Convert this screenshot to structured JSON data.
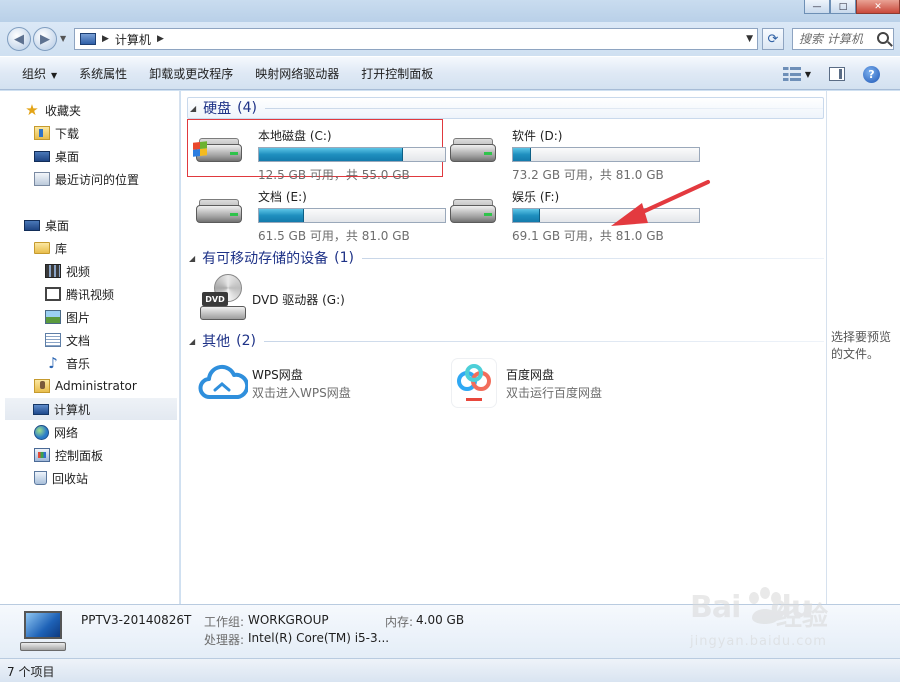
{
  "window": {
    "caption_buttons": [
      "minimize",
      "maximize",
      "close"
    ]
  },
  "address_bar": {
    "crumbs": [
      "计算机"
    ],
    "search_placeholder": "搜索 计算机"
  },
  "toolbar": {
    "organize_label": "组织",
    "system_properties_label": "系统属性",
    "uninstall_label": "卸载或更改程序",
    "map_drive_label": "映射网络驱动器",
    "control_panel_label": "打开控制面板"
  },
  "nav_pane": {
    "favorites_label": "收藏夹",
    "favorites": [
      {
        "label": "下载",
        "icon": "download-folder-icon"
      },
      {
        "label": "桌面",
        "icon": "desktop-icon"
      },
      {
        "label": "最近访问的位置",
        "icon": "recent-places-icon"
      }
    ],
    "desktop_label": "桌面",
    "libraries_label": "库",
    "libraries": [
      {
        "label": "视频",
        "icon": "video-icon"
      },
      {
        "label": "腾讯视频",
        "icon": "tencent-video-icon"
      },
      {
        "label": "图片",
        "icon": "picture-icon"
      },
      {
        "label": "文档",
        "icon": "document-icon"
      },
      {
        "label": "音乐",
        "icon": "music-icon"
      }
    ],
    "administrator_label": "Administrator",
    "computer_label": "计算机",
    "network_label": "网络",
    "control_panel_label": "控制面板",
    "recycle_bin_label": "回收站",
    "selected": "计算机"
  },
  "content": {
    "hard_disks": {
      "title": "硬盘",
      "count": "(4)",
      "drives": [
        {
          "name": "本地磁盘 (C:)",
          "free": "12.5 GB 可用，共 55.0 GB",
          "used_fraction": 0.773,
          "system": true,
          "highlighted": true
        },
        {
          "name": "软件 (D:)",
          "free": "73.2 GB 可用，共 81.0 GB",
          "used_fraction": 0.096,
          "system": false,
          "highlighted": false
        },
        {
          "name": "文档 (E:)",
          "free": "61.5 GB 可用，共 81.0 GB",
          "used_fraction": 0.241,
          "system": false,
          "highlighted": false
        },
        {
          "name": "娱乐 (F:)",
          "free": "69.1 GB 可用，共 81.0 GB",
          "used_fraction": 0.147,
          "system": false,
          "highlighted": false
        }
      ]
    },
    "removable": {
      "title": "有可移动存储的设备",
      "count": "(1)",
      "dvd_name": "DVD 驱动器 (G:)",
      "dvd_badge": "DVD"
    },
    "other": {
      "title": "其他",
      "count": "(2)",
      "items": [
        {
          "name": "WPS网盘",
          "desc": "双击进入WPS网盘",
          "icon": "wps-cloud-icon"
        },
        {
          "name": "百度网盘",
          "desc": "双击运行百度网盘",
          "icon": "baidu-netdisk-icon"
        }
      ]
    }
  },
  "preview_pane": {
    "text": "选择要预览的文件。"
  },
  "details_pane": {
    "computer_name": "PPTV3-20140826T",
    "workgroup_label": "工作组:",
    "workgroup_value": "WORKGROUP",
    "memory_label": "内存:",
    "memory_value": "4.00 GB",
    "processor_label": "处理器:",
    "processor_value": "Intel(R) Core(TM) i5-3..."
  },
  "status_bar": {
    "text": "7 个项目"
  },
  "watermark": {
    "brand": "Bai",
    "brand_tail": "du",
    "jingyan": "经验",
    "url": "jingyan.baidu.com"
  },
  "colors": {
    "drive_fill": "#1f8fbf",
    "highlight_box": "#e0393e",
    "group_title": "#1e3287"
  }
}
